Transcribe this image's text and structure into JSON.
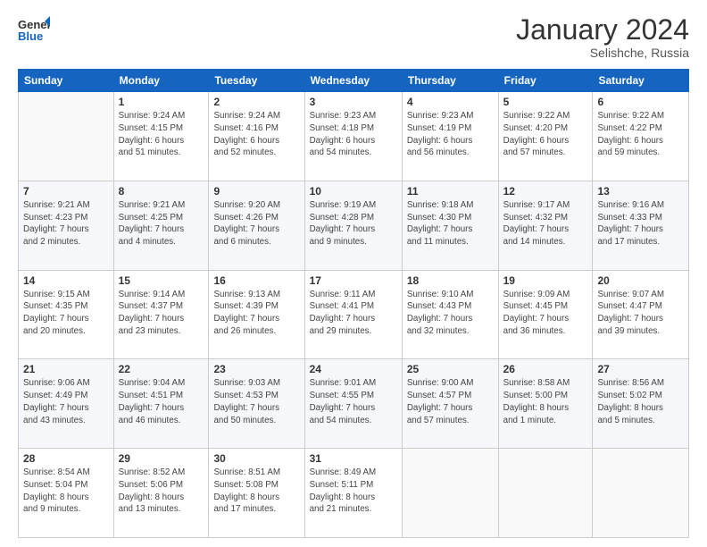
{
  "logo": {
    "general": "General",
    "blue": "Blue"
  },
  "header": {
    "month": "January 2024",
    "location": "Selishche, Russia"
  },
  "weekdays": [
    "Sunday",
    "Monday",
    "Tuesday",
    "Wednesday",
    "Thursday",
    "Friday",
    "Saturday"
  ],
  "weeks": [
    [
      {
        "day": "",
        "info": ""
      },
      {
        "day": "1",
        "info": "Sunrise: 9:24 AM\nSunset: 4:15 PM\nDaylight: 6 hours\nand 51 minutes."
      },
      {
        "day": "2",
        "info": "Sunrise: 9:24 AM\nSunset: 4:16 PM\nDaylight: 6 hours\nand 52 minutes."
      },
      {
        "day": "3",
        "info": "Sunrise: 9:23 AM\nSunset: 4:18 PM\nDaylight: 6 hours\nand 54 minutes."
      },
      {
        "day": "4",
        "info": "Sunrise: 9:23 AM\nSunset: 4:19 PM\nDaylight: 6 hours\nand 56 minutes."
      },
      {
        "day": "5",
        "info": "Sunrise: 9:22 AM\nSunset: 4:20 PM\nDaylight: 6 hours\nand 57 minutes."
      },
      {
        "day": "6",
        "info": "Sunrise: 9:22 AM\nSunset: 4:22 PM\nDaylight: 6 hours\nand 59 minutes."
      }
    ],
    [
      {
        "day": "7",
        "info": "Sunrise: 9:21 AM\nSunset: 4:23 PM\nDaylight: 7 hours\nand 2 minutes."
      },
      {
        "day": "8",
        "info": "Sunrise: 9:21 AM\nSunset: 4:25 PM\nDaylight: 7 hours\nand 4 minutes."
      },
      {
        "day": "9",
        "info": "Sunrise: 9:20 AM\nSunset: 4:26 PM\nDaylight: 7 hours\nand 6 minutes."
      },
      {
        "day": "10",
        "info": "Sunrise: 9:19 AM\nSunset: 4:28 PM\nDaylight: 7 hours\nand 9 minutes."
      },
      {
        "day": "11",
        "info": "Sunrise: 9:18 AM\nSunset: 4:30 PM\nDaylight: 7 hours\nand 11 minutes."
      },
      {
        "day": "12",
        "info": "Sunrise: 9:17 AM\nSunset: 4:32 PM\nDaylight: 7 hours\nand 14 minutes."
      },
      {
        "day": "13",
        "info": "Sunrise: 9:16 AM\nSunset: 4:33 PM\nDaylight: 7 hours\nand 17 minutes."
      }
    ],
    [
      {
        "day": "14",
        "info": "Sunrise: 9:15 AM\nSunset: 4:35 PM\nDaylight: 7 hours\nand 20 minutes."
      },
      {
        "day": "15",
        "info": "Sunrise: 9:14 AM\nSunset: 4:37 PM\nDaylight: 7 hours\nand 23 minutes."
      },
      {
        "day": "16",
        "info": "Sunrise: 9:13 AM\nSunset: 4:39 PM\nDaylight: 7 hours\nand 26 minutes."
      },
      {
        "day": "17",
        "info": "Sunrise: 9:11 AM\nSunset: 4:41 PM\nDaylight: 7 hours\nand 29 minutes."
      },
      {
        "day": "18",
        "info": "Sunrise: 9:10 AM\nSunset: 4:43 PM\nDaylight: 7 hours\nand 32 minutes."
      },
      {
        "day": "19",
        "info": "Sunrise: 9:09 AM\nSunset: 4:45 PM\nDaylight: 7 hours\nand 36 minutes."
      },
      {
        "day": "20",
        "info": "Sunrise: 9:07 AM\nSunset: 4:47 PM\nDaylight: 7 hours\nand 39 minutes."
      }
    ],
    [
      {
        "day": "21",
        "info": "Sunrise: 9:06 AM\nSunset: 4:49 PM\nDaylight: 7 hours\nand 43 minutes."
      },
      {
        "day": "22",
        "info": "Sunrise: 9:04 AM\nSunset: 4:51 PM\nDaylight: 7 hours\nand 46 minutes."
      },
      {
        "day": "23",
        "info": "Sunrise: 9:03 AM\nSunset: 4:53 PM\nDaylight: 7 hours\nand 50 minutes."
      },
      {
        "day": "24",
        "info": "Sunrise: 9:01 AM\nSunset: 4:55 PM\nDaylight: 7 hours\nand 54 minutes."
      },
      {
        "day": "25",
        "info": "Sunrise: 9:00 AM\nSunset: 4:57 PM\nDaylight: 7 hours\nand 57 minutes."
      },
      {
        "day": "26",
        "info": "Sunrise: 8:58 AM\nSunset: 5:00 PM\nDaylight: 8 hours\nand 1 minute."
      },
      {
        "day": "27",
        "info": "Sunrise: 8:56 AM\nSunset: 5:02 PM\nDaylight: 8 hours\nand 5 minutes."
      }
    ],
    [
      {
        "day": "28",
        "info": "Sunrise: 8:54 AM\nSunset: 5:04 PM\nDaylight: 8 hours\nand 9 minutes."
      },
      {
        "day": "29",
        "info": "Sunrise: 8:52 AM\nSunset: 5:06 PM\nDaylight: 8 hours\nand 13 minutes."
      },
      {
        "day": "30",
        "info": "Sunrise: 8:51 AM\nSunset: 5:08 PM\nDaylight: 8 hours\nand 17 minutes."
      },
      {
        "day": "31",
        "info": "Sunrise: 8:49 AM\nSunset: 5:11 PM\nDaylight: 8 hours\nand 21 minutes."
      },
      {
        "day": "",
        "info": ""
      },
      {
        "day": "",
        "info": ""
      },
      {
        "day": "",
        "info": ""
      }
    ]
  ]
}
